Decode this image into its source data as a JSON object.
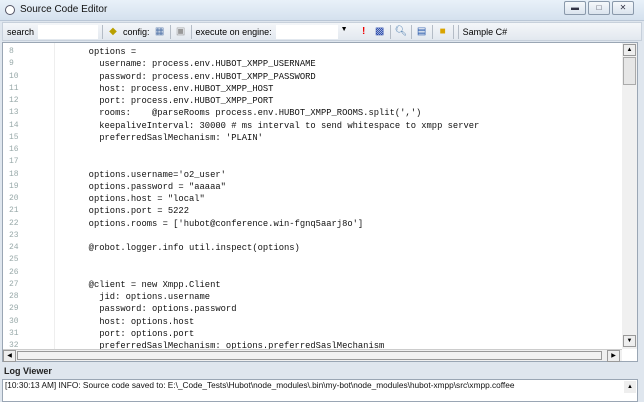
{
  "window": {
    "title": "Source Code Editor"
  },
  "toolbar": {
    "search_label": "search",
    "search_value": "",
    "config_label": "config:",
    "engine_label": "execute on engine:",
    "engine_value": "",
    "sample_label": "Sample C#"
  },
  "editor": {
    "lines": [
      {
        "n": "8",
        "t": "      options ="
      },
      {
        "n": "9",
        "t": "        username: process.env.HUBOT_XMPP_USERNAME"
      },
      {
        "n": "10",
        "t": "        password: process.env.HUBOT_XMPP_PASSWORD"
      },
      {
        "n": "11",
        "t": "        host: process.env.HUBOT_XMPP_HOST"
      },
      {
        "n": "12",
        "t": "        port: process.env.HUBOT_XMPP_PORT"
      },
      {
        "n": "13",
        "t": "        rooms:    @parseRooms process.env.HUBOT_XMPP_ROOMS.split(',')"
      },
      {
        "n": "14",
        "t": "        keepaliveInterval: 30000 # ms interval to send whitespace to xmpp server"
      },
      {
        "n": "15",
        "t": "        preferredSaslMechanism: 'PLAIN'"
      },
      {
        "n": "16",
        "t": ""
      },
      {
        "n": "17",
        "t": ""
      },
      {
        "n": "18",
        "t": "      options.username='o2_user'"
      },
      {
        "n": "19",
        "t": "      options.password = \"aaaaa\""
      },
      {
        "n": "20",
        "t": "      options.host = \"local\""
      },
      {
        "n": "21",
        "t": "      options.port = 5222"
      },
      {
        "n": "22",
        "t": "      options.rooms = ['hubot@conference.win-fgnq5aarj8o']"
      },
      {
        "n": "23",
        "t": ""
      },
      {
        "n": "24",
        "t": "      @robot.logger.info util.inspect(options)"
      },
      {
        "n": "25",
        "t": ""
      },
      {
        "n": "26",
        "t": ""
      },
      {
        "n": "27",
        "t": "      @client = new Xmpp.Client"
      },
      {
        "n": "28",
        "t": "        jid: options.username"
      },
      {
        "n": "29",
        "t": "        password: options.password"
      },
      {
        "n": "30",
        "t": "        host: options.host"
      },
      {
        "n": "31",
        "t": "        port: options.port"
      },
      {
        "n": "32",
        "t": "        preferredSaslMechanism: options.preferredSaslMechanism"
      }
    ]
  },
  "log": {
    "title": "Log Viewer",
    "lines": [
      "[10:30:13 AM] INFO: Source code saved to: E:\\_Code_Tests\\Hubot\\node_modules\\.bin\\my-bot\\node_modules\\hubot-xmpp\\src\\xmpp.coffee"
    ]
  }
}
